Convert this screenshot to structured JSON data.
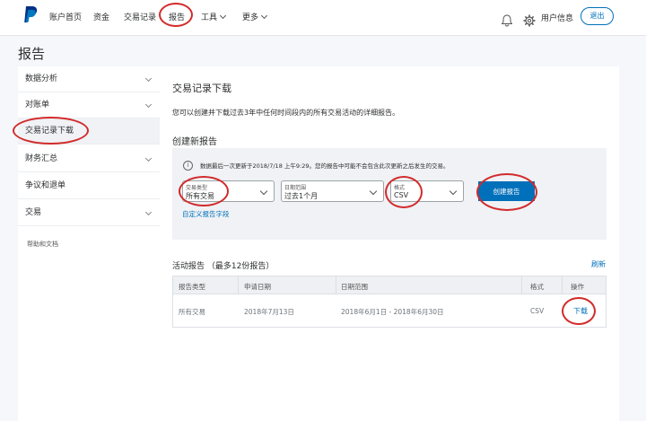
{
  "nav": {
    "items": [
      {
        "label": "账户首页"
      },
      {
        "label": "资金"
      },
      {
        "label": "交易记录"
      },
      {
        "label": "报告"
      },
      {
        "label": "工具"
      },
      {
        "label": "更多"
      }
    ],
    "user_label": "用户信息",
    "logout_label": "退出"
  },
  "page": {
    "title": "报告"
  },
  "sidebar": {
    "items": [
      {
        "label": "数据分析"
      },
      {
        "label": "对账单"
      },
      {
        "label": "交易记录下载"
      },
      {
        "label": "财务汇总"
      },
      {
        "label": "争议和退单"
      },
      {
        "label": "交易"
      }
    ],
    "help": "帮助和文档"
  },
  "main": {
    "title": "交易记录下载",
    "description": "您可以创建并下载过去3年中任何时间段内的所有交易活动的详细报告。",
    "create_section_title": "创建新报告",
    "info_text": "数据最后一次更新于2018/7/18 上午9:29。您的报告中可能不会包含此次更新之后发生的交易。",
    "filters": [
      {
        "label": "交易类型",
        "value": "所有交易"
      },
      {
        "label": "日期范围",
        "value": "过去1个月"
      },
      {
        "label": "格式",
        "value": "CSV"
      }
    ],
    "create_button": "创建报告",
    "custom_fields_link": "自定义报告字段",
    "activity_title": "活动报告 （最多12份报告）",
    "refresh_label": "刷新",
    "table": {
      "headers": [
        "报告类型",
        "申请日期",
        "日期范围",
        "格式",
        "操作"
      ],
      "rows": [
        {
          "type": "所有交易",
          "request_date": "2018年7月13日",
          "range": "2018年6月1日 - 2018年6月30日",
          "format": "CSV",
          "action": "下载"
        }
      ]
    }
  },
  "colors": {
    "accent": "#0070ba",
    "highlight": "#d22b2b"
  }
}
